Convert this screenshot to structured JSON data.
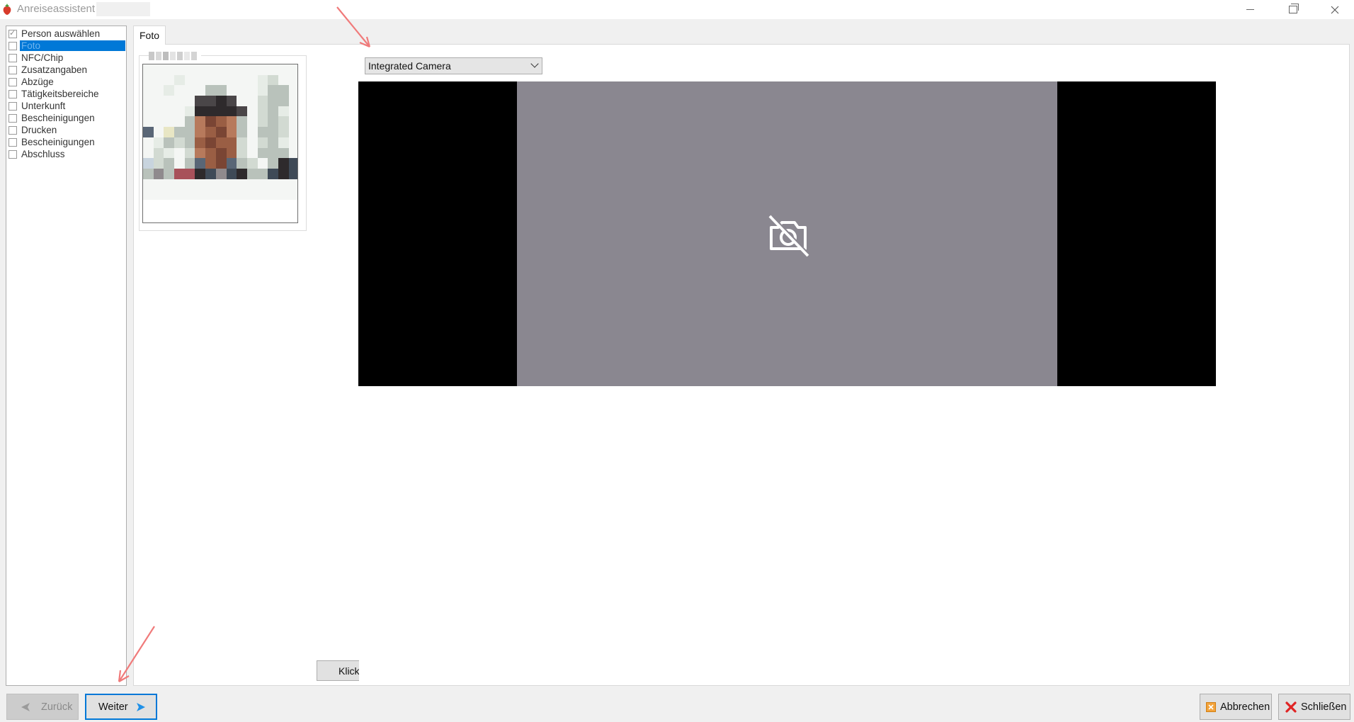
{
  "window": {
    "title": "Anreiseassistent",
    "controls": [
      "minimize-icon",
      "restore-icon",
      "close-icon"
    ]
  },
  "nav": {
    "items": [
      {
        "label": "Person auswählen",
        "checked": true,
        "selected": false
      },
      {
        "label": "Foto",
        "checked": false,
        "selected": true
      },
      {
        "label": "NFC/Chip",
        "checked": false,
        "selected": false
      },
      {
        "label": "Zusatzangaben",
        "checked": false,
        "selected": false
      },
      {
        "label": "Abzüge",
        "checked": false,
        "selected": false
      },
      {
        "label": "Tätigkeitsbereiche",
        "checked": false,
        "selected": false
      },
      {
        "label": "Unterkunft",
        "checked": false,
        "selected": false
      },
      {
        "label": "Bescheinigungen",
        "checked": false,
        "selected": false
      },
      {
        "label": "Drucken",
        "checked": false,
        "selected": false
      },
      {
        "label": "Bescheinigungen",
        "checked": false,
        "selected": false
      },
      {
        "label": "Abschluss",
        "checked": false,
        "selected": false
      }
    ]
  },
  "tabs": [
    {
      "label": "Foto",
      "active": true
    }
  ],
  "camera": {
    "selected": "Integrated Camera",
    "preview_icon": "camera-off-icon"
  },
  "buttons": {
    "klick": "Klick",
    "back": "Zurück",
    "next": "Weiter",
    "cancel": "Abbrechen",
    "close": "Schließen"
  },
  "colors": {
    "accent": "#0078d7",
    "selection": "#0078d7",
    "video_bg": "#000000",
    "preview_bg": "#8a8790",
    "annotation": "#f07a7a"
  }
}
